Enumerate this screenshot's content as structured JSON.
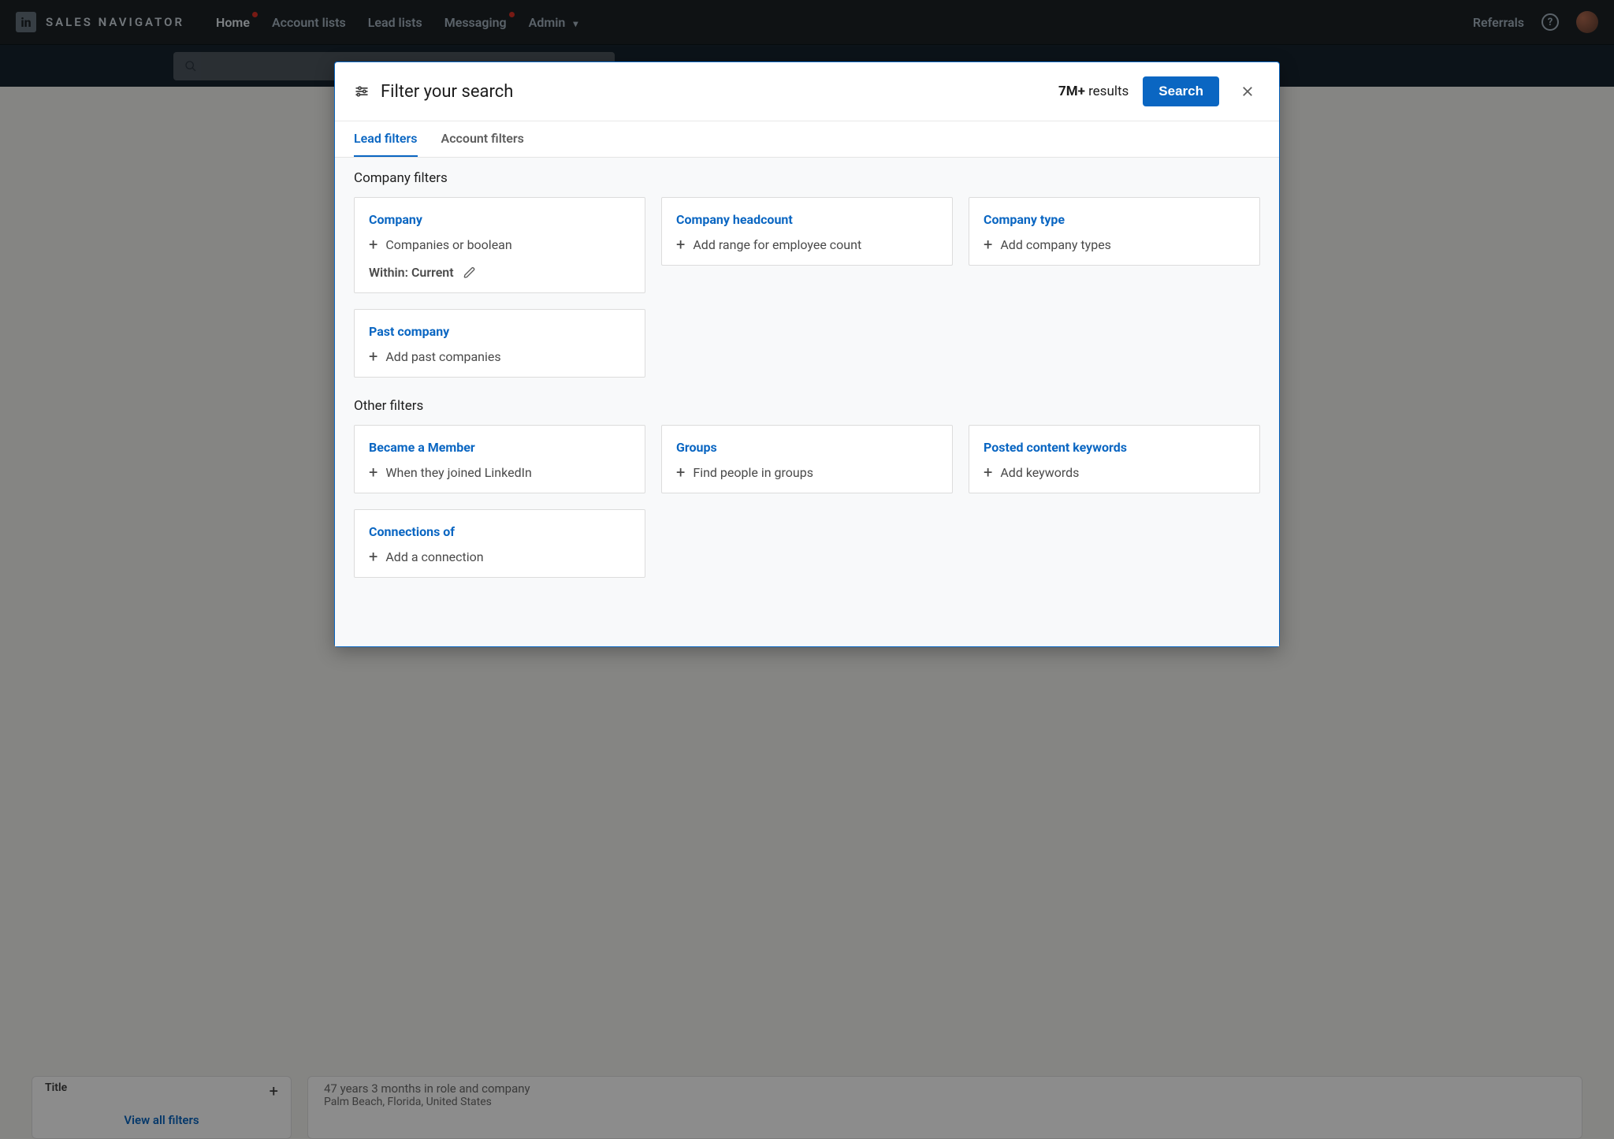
{
  "nav": {
    "brand": "SALES NAVIGATOR",
    "links": {
      "home": "Home",
      "account_lists": "Account lists",
      "lead_lists": "Lead lists",
      "messaging": "Messaging",
      "admin": "Admin"
    },
    "referrals": "Referrals"
  },
  "modal": {
    "title": "Filter your search",
    "results_count": "7M+",
    "results_word": "results",
    "search_button": "Search",
    "tabs": {
      "lead": "Lead filters",
      "account": "Account filters"
    },
    "sections": {
      "company": "Company filters",
      "other": "Other filters"
    },
    "cards": {
      "company": {
        "title": "Company",
        "action": "Companies or boolean",
        "extra_label": "Within: Current"
      },
      "headcount": {
        "title": "Company headcount",
        "action": "Add range for employee count"
      },
      "type": {
        "title": "Company type",
        "action": "Add company types"
      },
      "past_company": {
        "title": "Past company",
        "action": "Add past companies"
      },
      "became_member": {
        "title": "Became a Member",
        "action": "When they joined LinkedIn"
      },
      "groups": {
        "title": "Groups",
        "action": "Find people in groups"
      },
      "posted_keywords": {
        "title": "Posted content keywords",
        "action": "Add keywords"
      },
      "connections_of": {
        "title": "Connections of",
        "action": "Add a connection"
      }
    }
  },
  "backdrop": {
    "left": {
      "title": "Title",
      "view_all": "View all filters"
    },
    "right": {
      "tenure": "47 years 3 months in role and company",
      "location": "Palm Beach, Florida, United States"
    }
  }
}
